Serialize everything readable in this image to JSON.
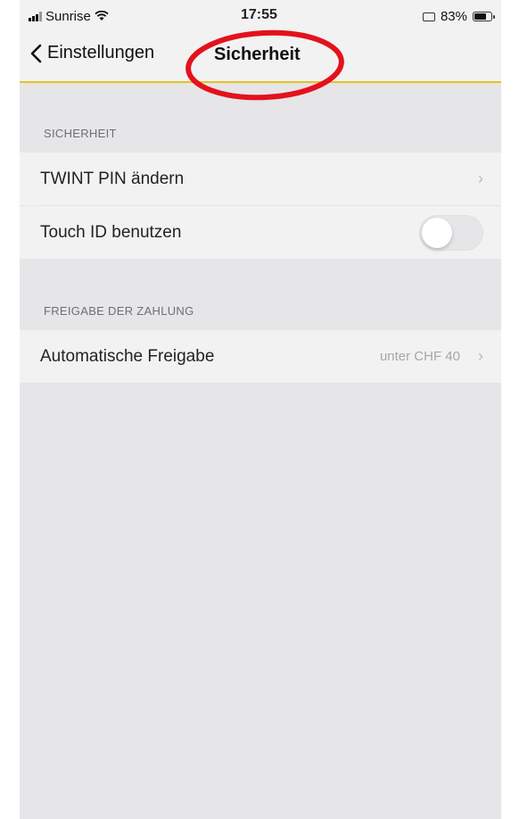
{
  "status_bar": {
    "carrier": "Sunrise",
    "time": "17:55",
    "battery": "83%",
    "battery_level": 0.83
  },
  "nav": {
    "back_label": "Einstellungen",
    "title": "Sicherheit"
  },
  "sections": [
    {
      "header": "SICHERHEIT",
      "rows": [
        {
          "label": "TWINT PIN ändern"
        },
        {
          "label": "Touch ID benutzen",
          "toggle": false
        }
      ]
    },
    {
      "header": "FREIGABE DER ZAHLUNG",
      "rows": [
        {
          "label": "Automatische Freigabe",
          "value": "unter CHF 40"
        }
      ]
    }
  ],
  "annotation": {
    "color": "#e3121c",
    "shape": "ellipse"
  },
  "colors": {
    "accent": "#e9c31d",
    "background": "#e6e5e8",
    "row": "#f2f2f2"
  }
}
